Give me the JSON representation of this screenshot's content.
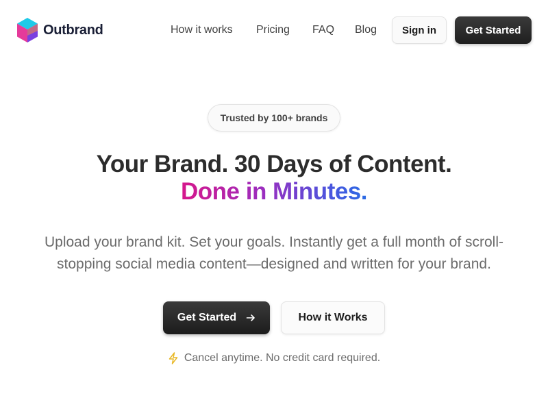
{
  "brand": {
    "name": "Outbrand"
  },
  "nav": {
    "items": [
      {
        "label": "How it works"
      },
      {
        "label": "Pricing"
      },
      {
        "label": "FAQ"
      },
      {
        "label": "Blog"
      }
    ],
    "signin_label": "Sign in",
    "get_started_label": "Get Started"
  },
  "hero": {
    "badge": "Trusted by 100+ brands",
    "headline_line1": "Your Brand. 30 Days of Content.",
    "headline_line2": "Done in Minutes.",
    "subtitle_line1": "Upload your brand kit. Set your goals. Instantly get a full month of scroll-",
    "subtitle_line2": "stopping social media content—designed and written for your brand.",
    "cta_primary": "Get Started",
    "cta_secondary": "How it Works",
    "note": "Cancel anytime. No credit card required."
  },
  "icons": {
    "logo": "cube-logo-icon",
    "cta_arrow": "arrow-right-icon",
    "note": "lightning-bolt-icon"
  },
  "colors": {
    "primary_dark": "#1f1f1f",
    "gradient_start": "#d6168b",
    "gradient_mid": "#9a2ec0",
    "gradient_end": "#2a6be4",
    "bolt": "#e8b724"
  }
}
